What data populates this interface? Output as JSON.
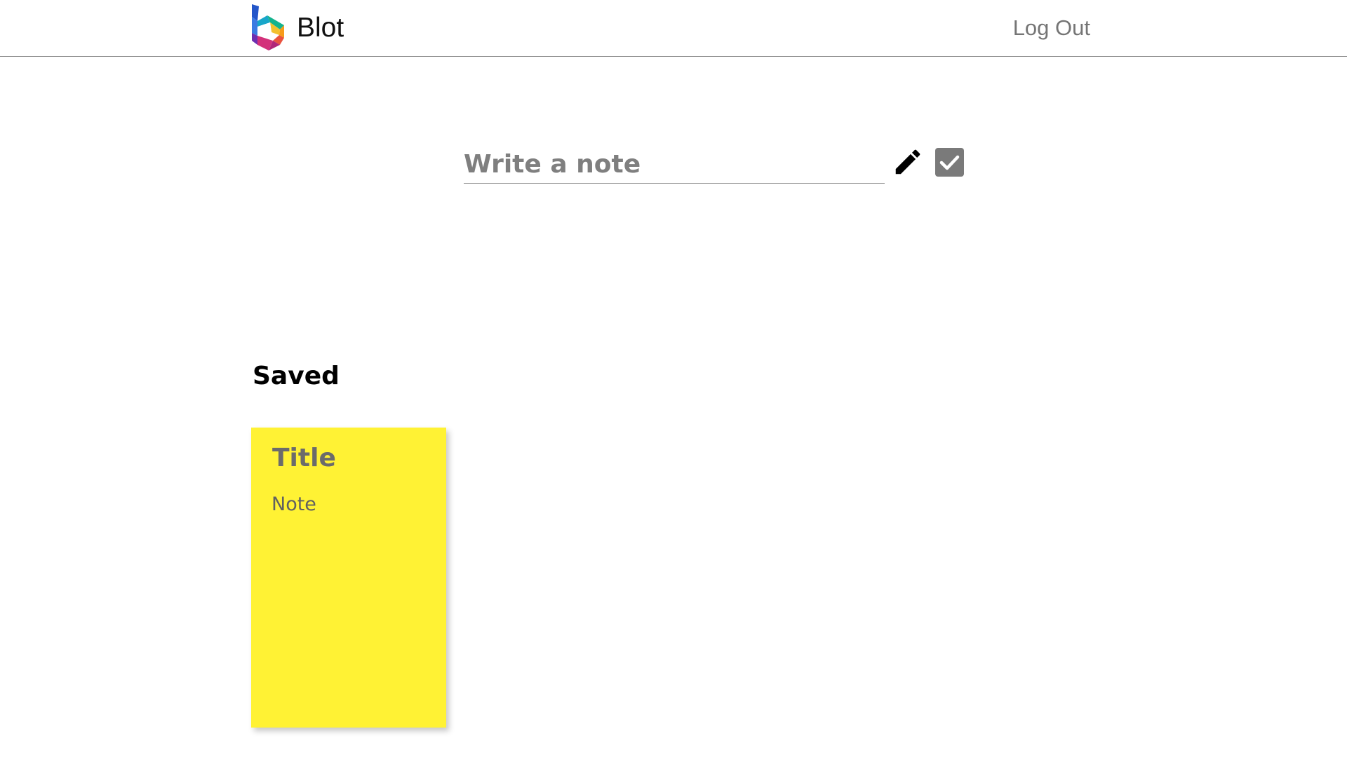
{
  "header": {
    "brand_name": "Blot",
    "logo_icon": "blot-logo-icon",
    "logout_label": "Log Out"
  },
  "composer": {
    "placeholder": "Write a note",
    "value": "",
    "edit_icon": "pencil-icon",
    "save_icon": "checkbox-check-icon"
  },
  "saved": {
    "heading": "Saved",
    "notes": [
      {
        "title": "Title",
        "body": "Note",
        "color": "#fff234"
      }
    ]
  },
  "colors": {
    "note_yellow": "#fff234",
    "muted_text": "#757575",
    "icon_gray": "#7a7a7a"
  }
}
